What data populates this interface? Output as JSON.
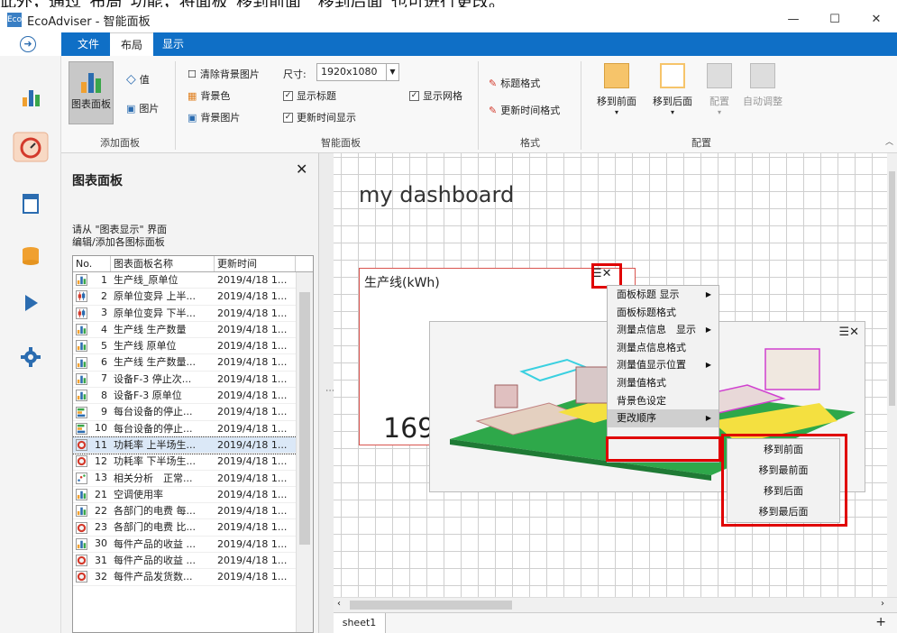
{
  "caption": "此外，通过“布局”功能，将面板“移到前面”“移到后面”也可进行更改。",
  "window": {
    "title": "EcoAdviser - 智能面板",
    "app_icon": "app-logo-icon",
    "minimize": "—",
    "maximize": "☐",
    "close": "✕"
  },
  "menu": {
    "tabs": [
      {
        "label": "文件",
        "active": false
      },
      {
        "label": "布局",
        "active": true
      },
      {
        "label": "显示",
        "active": false
      }
    ]
  },
  "ribbon": {
    "chart_panel": "图表面板",
    "value": "值",
    "image": "图片",
    "add_panel_group": "添加面板",
    "clear_bg_image": "清除背景图片",
    "bg_color": "背景色",
    "bg_image": "背景图片",
    "size_label": "尺寸:",
    "size_value": "1920x1080",
    "show_title": "显示标题",
    "show_update_time": "更新时间显示",
    "show_grid": "显示网格",
    "smart_panel_group": "智能面板",
    "title_format": "标题格式",
    "update_time_format": "更新时间格式",
    "format_group": "格式",
    "bring_forward": "移到前面",
    "send_backward": "移到后面",
    "arrange": "配置",
    "auto_adjust": "自动调整",
    "arrange_group": "配置"
  },
  "panel": {
    "title": "图表面板",
    "hint_line1": "请从 \"图表显示\" 界面",
    "hint_line2": "编辑/添加各图标面板",
    "columns": [
      "No.",
      "图表面板名称",
      "更新时间"
    ],
    "rows": [
      {
        "no": "1",
        "name": "生产线_原单位",
        "time": "2019/4/18 1...",
        "icon": "bar-chart-icon"
      },
      {
        "no": "2",
        "name": "原单位变异 上半...",
        "time": "2019/4/18 1...",
        "icon": "candlestick-icon"
      },
      {
        "no": "3",
        "name": "原单位变异 下半...",
        "time": "2019/4/18 1...",
        "icon": "candlestick-icon"
      },
      {
        "no": "4",
        "name": "生产线 生产数量",
        "time": "2019/4/18 1...",
        "icon": "bar-chart-icon"
      },
      {
        "no": "5",
        "name": "生产线 原单位",
        "time": "2019/4/18 1...",
        "icon": "bar-chart-icon"
      },
      {
        "no": "6",
        "name": "生产线 生产数量...",
        "time": "2019/4/18 1...",
        "icon": "bar-chart-icon"
      },
      {
        "no": "7",
        "name": "设备F-3 停止次...",
        "time": "2019/4/18 1...",
        "icon": "bar-chart-icon"
      },
      {
        "no": "8",
        "name": "设备F-3 原单位",
        "time": "2019/4/18 1...",
        "icon": "bar-chart-icon"
      },
      {
        "no": "9",
        "name": "每台设备的停止...",
        "time": "2019/4/18 1...",
        "icon": "hbar-chart-icon"
      },
      {
        "no": "10",
        "name": "每台设备的停止...",
        "time": "2019/4/18 1...",
        "icon": "hbar-chart-icon"
      },
      {
        "no": "11",
        "name": "功耗率 上半场生...",
        "time": "2019/4/18 1...",
        "icon": "gauge-icon",
        "selected": true
      },
      {
        "no": "12",
        "name": "功耗率 下半场生...",
        "time": "2019/4/18 1...",
        "icon": "gauge-icon"
      },
      {
        "no": "13",
        "name": "相关分析　正常...",
        "time": "2019/4/18 1...",
        "icon": "scatter-icon"
      },
      {
        "no": "21",
        "name": "空调使用率",
        "time": "2019/4/18 1...",
        "icon": "bar-chart-icon"
      },
      {
        "no": "22",
        "name": "各部门的电费 每...",
        "time": "2019/4/18 1...",
        "icon": "bar-chart-icon"
      },
      {
        "no": "23",
        "name": "各部门的电费 比...",
        "time": "2019/4/18 1...",
        "icon": "gauge-icon"
      },
      {
        "no": "30",
        "name": "每件产品的收益 ...",
        "time": "2019/4/18 1...",
        "icon": "bar-chart-icon"
      },
      {
        "no": "31",
        "name": "每件产品的收益 ...",
        "time": "2019/4/18 1...",
        "icon": "gauge-icon"
      },
      {
        "no": "32",
        "name": "每件产品发货数...",
        "time": "2019/4/18 1...",
        "icon": "gauge-icon"
      }
    ]
  },
  "canvas": {
    "dashboard_title": "my dashboard",
    "card1_title": "生产线(kWh)",
    "card1_value": "169[",
    "card_menu_glyph": "☰✕",
    "card2_menu_glyph": "☰✕"
  },
  "context_menu": {
    "items": [
      {
        "label": "面板标题 显示",
        "arrow": "▶"
      },
      {
        "label": "面板标题格式",
        "arrow": ""
      },
      {
        "label": "测量点信息　显示",
        "arrow": "▶"
      },
      {
        "label": "测量点信息格式",
        "arrow": ""
      },
      {
        "label": "测量值显示位置",
        "arrow": "▶"
      },
      {
        "label": "测量值格式",
        "arrow": ""
      },
      {
        "label": "背景色设定",
        "arrow": ""
      },
      {
        "label": "更改顺序",
        "arrow": "▶",
        "highlighted": true
      }
    ],
    "submenu": [
      "移到前面",
      "移到最前面",
      "移到后面",
      "移到最后面"
    ]
  },
  "footer": {
    "sheet_tab": "sheet1",
    "add_sheet": "+"
  },
  "colors": {
    "accent": "#0f6fc6",
    "highlight_box": "#e00000",
    "card_border": "#d9544f"
  }
}
